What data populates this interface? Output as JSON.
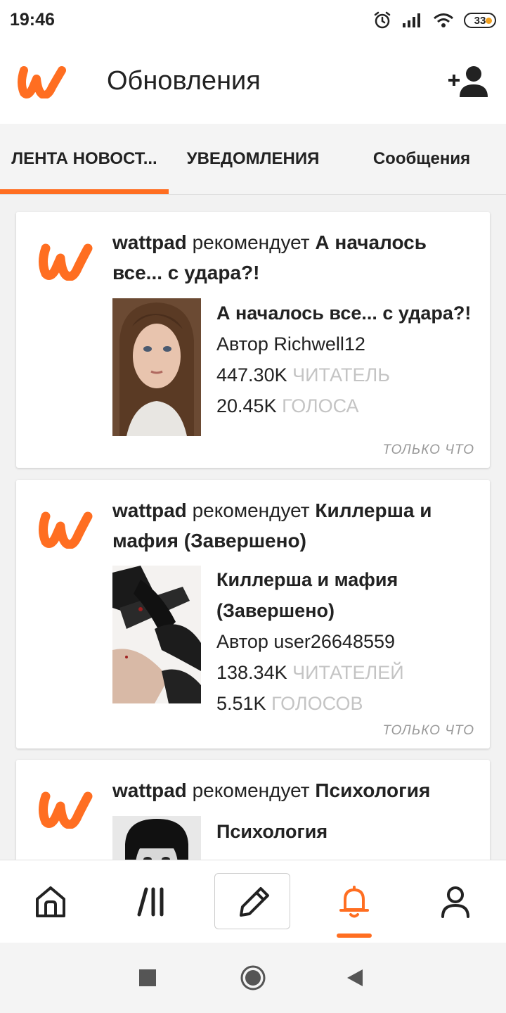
{
  "status_bar": {
    "time": "19:46",
    "battery": "33",
    "icons": [
      "alarm-icon",
      "signal-icon",
      "wifi-icon",
      "battery-icon"
    ]
  },
  "header": {
    "title": "Обновления",
    "logo_icon": "wattpad-logo-icon",
    "action_icon": "add-user-icon"
  },
  "tabs": [
    {
      "label": "ЛЕНТА НОВОСТ..."
    },
    {
      "label": "УВЕДОМЛЕНИЯ"
    },
    {
      "label": "Сообщения"
    }
  ],
  "feed": {
    "cards": [
      {
        "source": "wattpad",
        "verb": "рекомендует",
        "story_headline": "А началось все... с удара?!",
        "title": "А началось все... с удара?!",
        "author": "Автор Richwell12",
        "reads_value": "447.30K",
        "reads_label": "ЧИТАТЕЛЬ",
        "votes_value": "20.45K",
        "votes_label": "ГОЛОСА",
        "time": "ТОЛЬКО ЧТО"
      },
      {
        "source": "wattpad",
        "verb": "рекомендует",
        "story_headline": "Киллерша и мафия (Завершено)",
        "title_line1": "Киллерша и мафия",
        "title_line2": "(Завершено)",
        "author": "Автор user26648559",
        "reads_value": "138.34K",
        "reads_label": "ЧИТАТЕЛЕЙ",
        "votes_value": "5.51K",
        "votes_label": "ГОЛОСОВ",
        "time": "ТОЛЬКО ЧТО"
      },
      {
        "source": "wattpad",
        "verb": "рекомендует",
        "story_headline": "Психология",
        "title": "Психология"
      }
    ]
  },
  "bottom_nav": {
    "items": [
      "home-icon",
      "library-icon",
      "write-icon",
      "notifications-icon",
      "profile-icon"
    ],
    "active": "notifications-icon"
  },
  "colors": {
    "accent": "#ff6e21",
    "muted": "#c4c4c4",
    "text": "#222222"
  }
}
